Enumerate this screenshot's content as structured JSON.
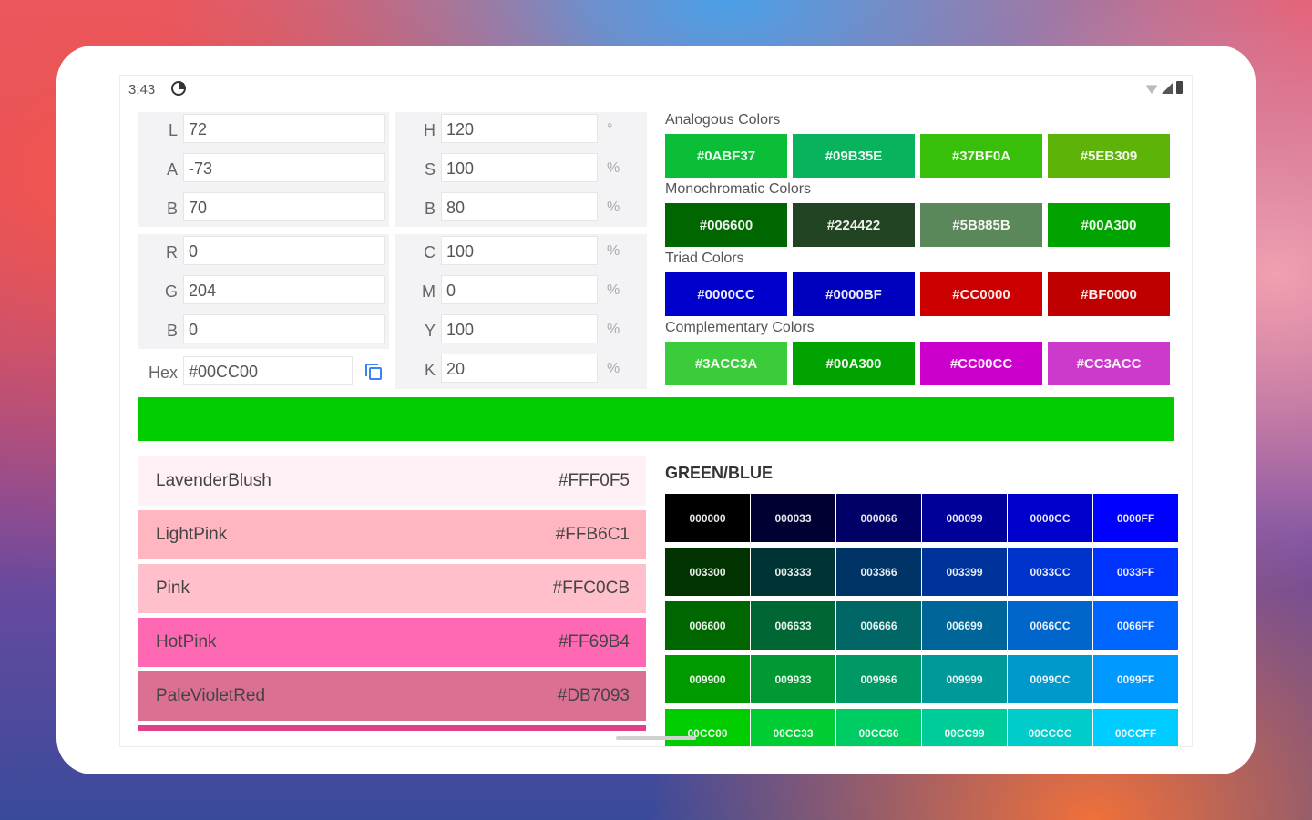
{
  "status": {
    "time": "3:43"
  },
  "lab": [
    {
      "label": "L",
      "value": "72"
    },
    {
      "label": "A",
      "value": "-73"
    },
    {
      "label": "B",
      "value": "70"
    }
  ],
  "hsb": [
    {
      "label": "H",
      "value": "120",
      "unit": "°"
    },
    {
      "label": "S",
      "value": "100",
      "unit": "%"
    },
    {
      "label": "B",
      "value": "80",
      "unit": "%"
    }
  ],
  "rgb": [
    {
      "label": "R",
      "value": "0"
    },
    {
      "label": "G",
      "value": "204"
    },
    {
      "label": "B",
      "value": "0"
    }
  ],
  "cmyk": [
    {
      "label": "C",
      "value": "100",
      "unit": "%"
    },
    {
      "label": "M",
      "value": "0",
      "unit": "%"
    },
    {
      "label": "Y",
      "value": "100",
      "unit": "%"
    },
    {
      "label": "K",
      "value": "20",
      "unit": "%"
    }
  ],
  "hex": {
    "label": "Hex",
    "value": "#00CC00"
  },
  "current_color": "#00CC00",
  "harmonies": [
    {
      "title": "Analogous Colors",
      "colors": [
        "#0ABF37",
        "#09B35E",
        "#37BF0A",
        "#5EB309"
      ]
    },
    {
      "title": "Monochromatic Colors",
      "colors": [
        "#006600",
        "#224422",
        "#5B885B",
        "#00A300"
      ]
    },
    {
      "title": "Triad Colors",
      "colors": [
        "#0000CC",
        "#0000BF",
        "#CC0000",
        "#BF0000"
      ]
    },
    {
      "title": "Complementary Colors",
      "colors": [
        "#3ACC3A",
        "#00A300",
        "#CC00CC",
        "#CC3ACC"
      ]
    }
  ],
  "named_colors": [
    {
      "name": "LavenderBlush",
      "hex": "#FFF0F5"
    },
    {
      "name": "LightPink",
      "hex": "#FFB6C1"
    },
    {
      "name": "Pink",
      "hex": "#FFC0CB"
    },
    {
      "name": "HotPink",
      "hex": "#FF69B4"
    },
    {
      "name": "PaleVioletRed",
      "hex": "#DB7093"
    }
  ],
  "named_partial_color": "#E0408A",
  "grid": {
    "title": "GREEN/BLUE",
    "rows": [
      [
        "000000",
        "000033",
        "000066",
        "000099",
        "0000CC",
        "0000FF"
      ],
      [
        "003300",
        "003333",
        "003366",
        "003399",
        "0033CC",
        "0033FF"
      ],
      [
        "006600",
        "006633",
        "006666",
        "006699",
        "0066CC",
        "0066FF"
      ],
      [
        "009900",
        "009933",
        "009966",
        "009999",
        "0099CC",
        "0099FF"
      ],
      [
        "00CC00",
        "00CC33",
        "00CC66",
        "00CC99",
        "00CCCC",
        "00CCFF"
      ]
    ]
  }
}
